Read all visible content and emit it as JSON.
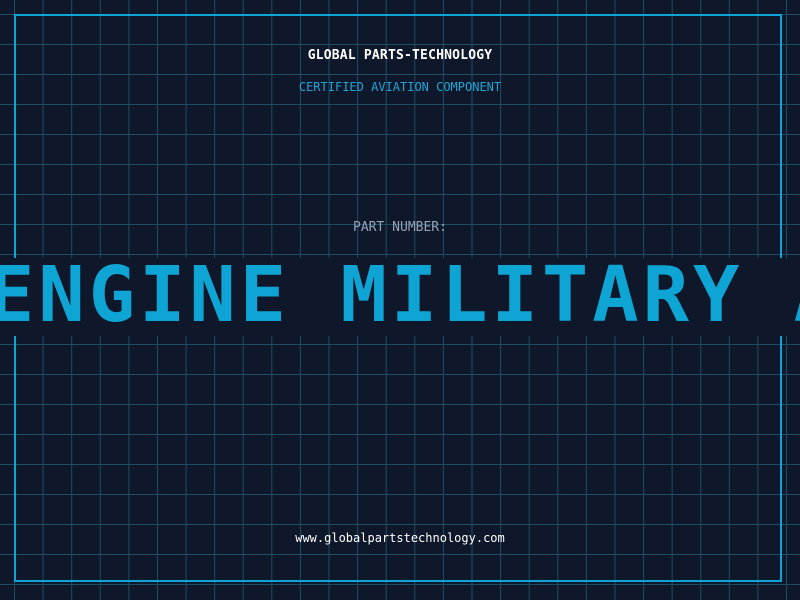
{
  "header": {
    "company": "GLOBAL PARTS-TECHNOLOGY",
    "subtitle": "CERTIFIED AVIATION COMPONENT"
  },
  "part": {
    "label": "PART NUMBER:",
    "value": "ENGINE MILITARY AIR"
  },
  "footer": {
    "website": "www.globalpartstechnology.com"
  },
  "colors": {
    "background": "#0f172a",
    "accent": "#0ea5d4",
    "grid": "#1e4d66"
  }
}
